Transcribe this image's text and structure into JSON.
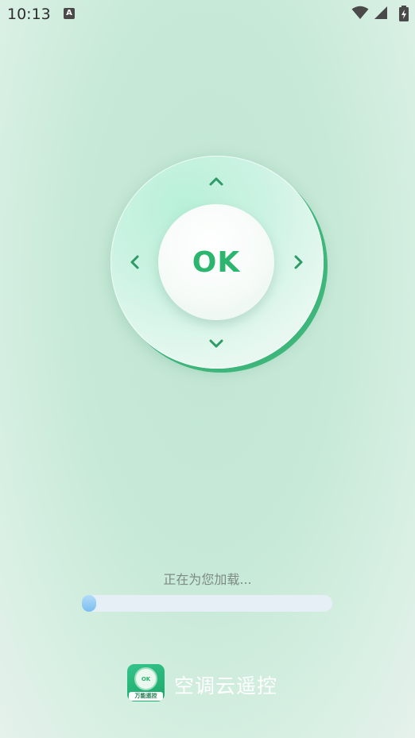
{
  "status_bar": {
    "time": "10:13",
    "notification_icon": "A",
    "icons": [
      "wifi-icon",
      "signal-icon",
      "battery-charging-icon"
    ]
  },
  "remote": {
    "ok_label": "OK",
    "arrows": [
      "up-arrow-icon",
      "down-arrow-icon",
      "left-arrow-icon",
      "right-arrow-icon"
    ],
    "accent_color": "#2bb56f"
  },
  "loading": {
    "text": "正在为您加载...",
    "progress": 0.03
  },
  "brand": {
    "icon_label": "OK",
    "icon_caption": "万能遥控",
    "app_name": "空调云遥控"
  }
}
